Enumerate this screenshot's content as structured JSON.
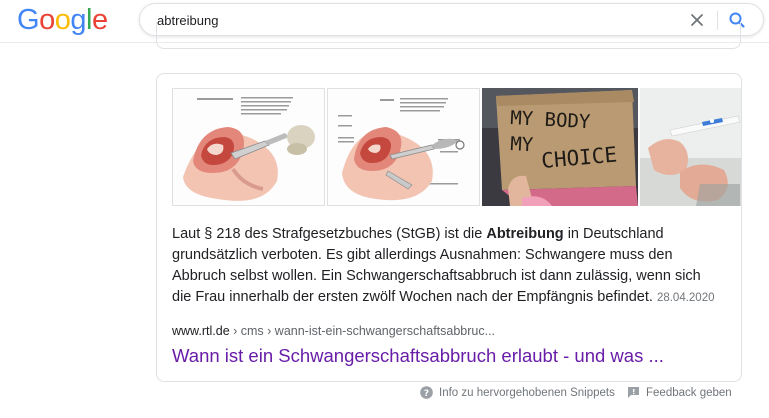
{
  "logo": {
    "text": "Google",
    "letters": [
      "G",
      "o",
      "o",
      "g",
      "l",
      "e"
    ],
    "colors": [
      "#4285F4",
      "#EA4335",
      "#FBBC05",
      "#4285F4",
      "#34A853",
      "#EA4335"
    ]
  },
  "search": {
    "query": "abtreibung"
  },
  "icons": {
    "clear": "close-icon",
    "search": "search-icon",
    "help": "help-circle-icon",
    "feedback": "feedback-icon"
  },
  "images": [
    {
      "name": "diagram-absaugmethode"
    },
    {
      "name": "diagram-schritt-a"
    },
    {
      "name": "my-body-my-choice-sign",
      "text": "MY BODY MY CHOICE"
    },
    {
      "name": "pregnancy-test"
    }
  ],
  "snippet": {
    "pre": "Laut § 218 des Strafgesetzbuches (StGB) ist die ",
    "bold": "Abtreibung",
    "post": " in Deutschland grundsätzlich verboten. Es gibt allerdings Ausnahmen: Schwangere muss den Abbruch selbst wollen. Ein Schwangerschaftsabbruch ist dann zulässig, wenn sich die Frau innerhalb der ersten zwölf Wochen nach der Empfängnis befindet.",
    "date": "28.04.2020"
  },
  "result": {
    "site": "www.rtl.de",
    "path": " › cms › wann-ist-ein-schwangerschaftsabbruc...",
    "title": "Wann ist ein Schwangerschaftsabbruch erlaubt - und was ..."
  },
  "footer": {
    "about_snippets": "Info zu hervorgehobenen Snippets",
    "feedback": "Feedback geben"
  },
  "colors": {
    "visited_link": "#681da8",
    "accent_blue": "#4285F4"
  }
}
